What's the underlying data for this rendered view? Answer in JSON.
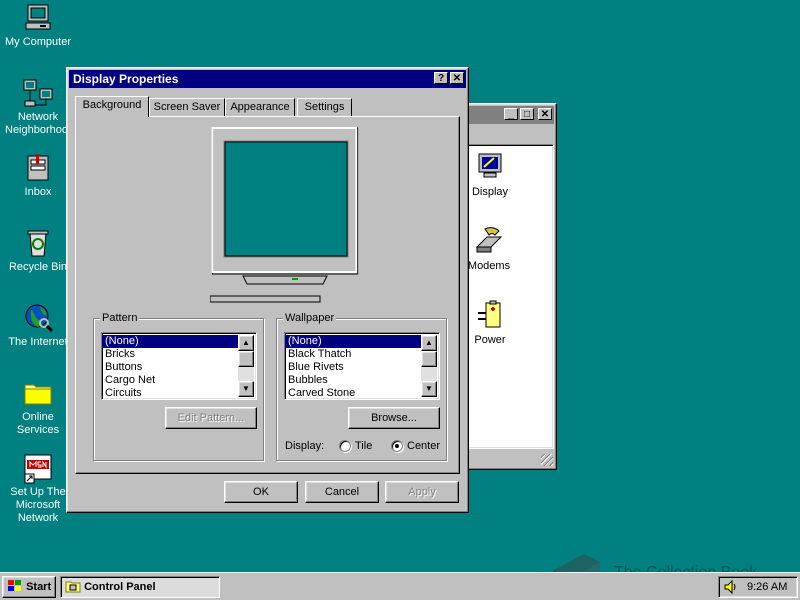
{
  "desktop": {
    "icons": [
      {
        "label": "My Computer"
      },
      {
        "label": "Network Neighborhood"
      },
      {
        "label": "Inbox"
      },
      {
        "label": "Recycle Bin"
      },
      {
        "label": "The Internet"
      },
      {
        "label": "Online Services"
      },
      {
        "label": "Set Up The Microsoft Network"
      }
    ]
  },
  "control_panel_window": {
    "items": [
      {
        "label": "Display",
        "icon": "display-icon"
      },
      {
        "label": "Modems",
        "icon": "modem-icon"
      },
      {
        "label": "Power",
        "icon": "power-icon"
      }
    ]
  },
  "display_dialog": {
    "title": "Display Properties",
    "help_glyph": "?",
    "close_glyph": "✕",
    "tabs": [
      {
        "label": "Background",
        "active": true
      },
      {
        "label": "Screen Saver"
      },
      {
        "label": "Appearance"
      },
      {
        "label": "Settings"
      }
    ],
    "preview_color": "#008080",
    "pattern": {
      "label": "Pattern",
      "items": [
        "(None)",
        "Bricks",
        "Buttons",
        "Cargo Net",
        "Circuits"
      ],
      "selected": "(None)",
      "edit_button": "Edit Pattern..."
    },
    "wallpaper": {
      "label": "Wallpaper",
      "items": [
        "(None)",
        "Black Thatch",
        "Blue Rivets",
        "Bubbles",
        "Carved Stone"
      ],
      "selected": "(None)",
      "browse_button": "Browse...",
      "display_label": "Display:",
      "options": [
        {
          "label": "Tile",
          "checked": false
        },
        {
          "label": "Center",
          "checked": true
        }
      ]
    },
    "buttons": {
      "ok": "OK",
      "cancel": "Cancel",
      "apply": "Apply"
    }
  },
  "taskbar": {
    "start_label": "Start",
    "tasks": [
      {
        "label": "Control Panel",
        "icon": "control-panel-icon"
      }
    ],
    "clock": "9:26 AM"
  },
  "watermark": "The Collection Book",
  "colors": {
    "desktop": "#008080",
    "titlebar_active": "#000080",
    "face": "#c0c0c0"
  }
}
